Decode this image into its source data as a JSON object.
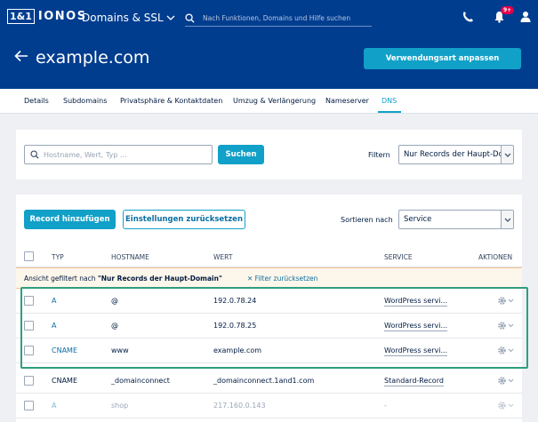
{
  "topbar": {
    "logo_box": "1&1",
    "logo_text": "IONOS",
    "product": "Domains & SSL",
    "search_placeholder": "Nach Funktionen, Domains und Hilfe suchen",
    "notification_count": "9+",
    "icons": [
      "chevron-down-icon",
      "search-icon",
      "phone-icon",
      "bell-icon",
      "user-icon"
    ]
  },
  "header": {
    "domain": "example.com",
    "usage_button": "Verwendungsart anpassen"
  },
  "tabs": [
    {
      "label": "Details"
    },
    {
      "label": "Subdomains"
    },
    {
      "label": "Privatsphäre & Kontaktdaten"
    },
    {
      "label": "Umzug & Verlängerung"
    },
    {
      "label": "Nameserver"
    },
    {
      "label": "DNS"
    }
  ],
  "search": {
    "placeholder": "Hostname, Wert, Typ ...",
    "button": "Suchen",
    "filter_label": "Filtern",
    "filter_value": "Nur Records der Haupt-Do"
  },
  "records": {
    "add_button": "Record hinzufügen",
    "reset_button": "Einstellungen zurücksetzen",
    "sort_label": "Sortieren nach",
    "sort_value": "Service",
    "columns": [
      "TYP",
      "HOSTNAME",
      "WERT",
      "SERVICE",
      "AKTIONEN"
    ],
    "filter_notice": {
      "prefix": "Ansicht gefiltert nach ",
      "value": "\"Nur Records der Haupt-Domain\"",
      "reset": "Filter zurücksetzen"
    },
    "rows": [
      {
        "type": "A",
        "host": "@",
        "value": "192.0.78.24",
        "service": "WordPress servi..."
      },
      {
        "type": "A",
        "host": "@",
        "value": "192.0.78.25",
        "service": "WordPress servi..."
      },
      {
        "type": "CNAME",
        "host": "www",
        "value": "example.com",
        "service": "WordPress servi..."
      },
      {
        "type": "CNAME",
        "host": "_domainconnect",
        "value": "_domainconnect.1and1.com",
        "service": "Standard-Record"
      },
      {
        "type": "A",
        "host": "shop",
        "value": "217.160.0.143",
        "service": "-"
      }
    ]
  },
  "colors": {
    "brand": "#003d8f",
    "accent": "#11a0c8",
    "highlight": "#2e9e80",
    "notice_bg": "#fdf6ea"
  }
}
